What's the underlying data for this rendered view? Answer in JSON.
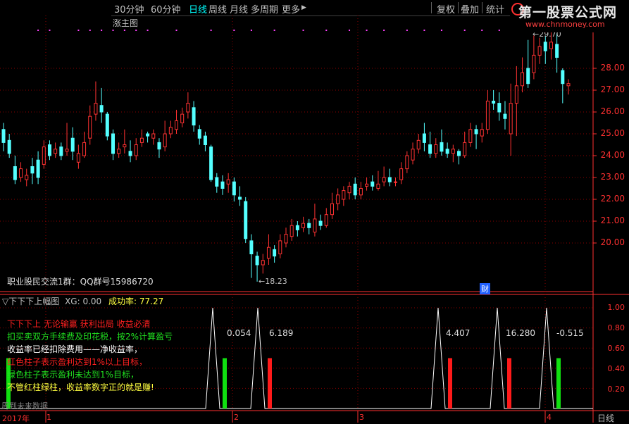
{
  "toolbar": {
    "periods": [
      "30分钟",
      "60分钟",
      "日线",
      "周线",
      "月线",
      "多周期",
      "更多"
    ],
    "active_index": 2,
    "more_arrow": "▶",
    "right_buttons": [
      "复权",
      "叠加",
      "统计"
    ]
  },
  "logo": {
    "main": "第一股票公式网",
    "sub": "www.chnmoney.com"
  },
  "main_chart": {
    "title": "涨主图",
    "label_high": "29.70",
    "label_low": "18.23",
    "qq_text": "职业股民交流1群：QQ群号15986720",
    "cai_badge": "财",
    "price_ticks": [
      "28.00",
      "27.00",
      "26.00",
      "25.00",
      "24.00",
      "23.00",
      "22.00",
      "21.00",
      "20.00"
    ],
    "ymin": 18.0,
    "ymax": 30.2,
    "candles": [
      {
        "o": 25.2,
        "c": 24.6,
        "h": 25.5,
        "l": 24.2
      },
      {
        "o": 24.7,
        "c": 24.1,
        "h": 25.0,
        "l": 23.9
      },
      {
        "o": 23.5,
        "c": 22.9,
        "h": 24.0,
        "l": 22.7
      },
      {
        "o": 23.0,
        "c": 23.4,
        "h": 23.7,
        "l": 22.8
      },
      {
        "o": 22.9,
        "c": 23.1,
        "h": 23.4,
        "l": 22.6
      },
      {
        "o": 23.5,
        "c": 23.2,
        "h": 23.9,
        "l": 22.7
      },
      {
        "o": 23.8,
        "c": 23.0,
        "h": 24.2,
        "l": 22.7
      },
      {
        "o": 23.6,
        "c": 24.4,
        "h": 24.7,
        "l": 23.4
      },
      {
        "o": 24.5,
        "c": 24.0,
        "h": 24.7,
        "l": 23.8
      },
      {
        "o": 24.1,
        "c": 24.3,
        "h": 24.6,
        "l": 23.9
      },
      {
        "o": 24.4,
        "c": 24.0,
        "h": 24.6,
        "l": 23.8
      },
      {
        "o": 24.2,
        "c": 24.3,
        "h": 25.5,
        "l": 24.0
      },
      {
        "o": 24.8,
        "c": 24.2,
        "h": 25.3,
        "l": 23.8
      },
      {
        "o": 23.7,
        "c": 24.1,
        "h": 24.5,
        "l": 23.4
      },
      {
        "o": 24.0,
        "c": 24.6,
        "h": 25.1,
        "l": 23.9
      },
      {
        "o": 24.8,
        "c": 25.8,
        "h": 26.3,
        "l": 24.5
      },
      {
        "o": 25.9,
        "c": 26.4,
        "h": 27.4,
        "l": 25.6
      },
      {
        "o": 26.3,
        "c": 26.0,
        "h": 27.1,
        "l": 25.5
      },
      {
        "o": 25.9,
        "c": 24.9,
        "h": 26.0,
        "l": 24.7
      },
      {
        "o": 25.0,
        "c": 24.1,
        "h": 25.2,
        "l": 23.8
      },
      {
        "o": 24.1,
        "c": 24.3,
        "h": 24.6,
        "l": 23.9
      },
      {
        "o": 24.4,
        "c": 24.5,
        "h": 25.2,
        "l": 24.1
      },
      {
        "o": 24.2,
        "c": 24.0,
        "h": 24.7,
        "l": 23.7
      },
      {
        "o": 24.0,
        "c": 24.5,
        "h": 24.8,
        "l": 23.8
      },
      {
        "o": 24.6,
        "c": 24.8,
        "h": 25.2,
        "l": 24.4
      },
      {
        "o": 25.0,
        "c": 24.9,
        "h": 25.1,
        "l": 24.6
      },
      {
        "o": 24.8,
        "c": 25.0,
        "h": 25.2,
        "l": 24.5
      },
      {
        "o": 24.6,
        "c": 24.3,
        "h": 24.8,
        "l": 23.9
      },
      {
        "o": 24.4,
        "c": 25.0,
        "h": 25.6,
        "l": 24.2
      },
      {
        "o": 25.0,
        "c": 25.3,
        "h": 25.6,
        "l": 24.8
      },
      {
        "o": 25.2,
        "c": 25.6,
        "h": 26.1,
        "l": 25.0
      },
      {
        "o": 25.5,
        "c": 25.9,
        "h": 26.2,
        "l": 25.3
      },
      {
        "o": 26.0,
        "c": 26.4,
        "h": 26.9,
        "l": 25.7
      },
      {
        "o": 26.2,
        "c": 25.4,
        "h": 26.5,
        "l": 25.1
      },
      {
        "o": 25.2,
        "c": 24.8,
        "h": 25.4,
        "l": 24.5
      },
      {
        "o": 24.9,
        "c": 24.5,
        "h": 25.1,
        "l": 24.2
      },
      {
        "o": 24.4,
        "c": 22.9,
        "h": 24.5,
        "l": 22.8
      },
      {
        "o": 23.0,
        "c": 22.6,
        "h": 23.2,
        "l": 22.3
      },
      {
        "o": 22.8,
        "c": 22.5,
        "h": 23.1,
        "l": 22.2
      },
      {
        "o": 22.7,
        "c": 22.9,
        "h": 23.2,
        "l": 22.3
      },
      {
        "o": 22.8,
        "c": 22.2,
        "h": 23.0,
        "l": 21.9
      },
      {
        "o": 22.1,
        "c": 22.0,
        "h": 22.6,
        "l": 21.7
      },
      {
        "o": 21.9,
        "c": 20.2,
        "h": 22.1,
        "l": 20.0
      },
      {
        "o": 20.1,
        "c": 19.5,
        "h": 20.4,
        "l": 18.4
      },
      {
        "o": 19.4,
        "c": 19.0,
        "h": 19.6,
        "l": 18.23
      },
      {
        "o": 19.0,
        "c": 19.2,
        "h": 19.5,
        "l": 18.6
      },
      {
        "o": 19.3,
        "c": 19.8,
        "h": 20.4,
        "l": 19.0
      },
      {
        "o": 19.7,
        "c": 19.4,
        "h": 19.9,
        "l": 19.1
      },
      {
        "o": 19.5,
        "c": 20.1,
        "h": 20.4,
        "l": 19.3
      },
      {
        "o": 20.0,
        "c": 20.4,
        "h": 20.7,
        "l": 19.8
      },
      {
        "o": 20.3,
        "c": 20.8,
        "h": 21.1,
        "l": 20.1
      },
      {
        "o": 20.8,
        "c": 20.6,
        "h": 21.0,
        "l": 20.3
      },
      {
        "o": 20.7,
        "c": 20.9,
        "h": 21.2,
        "l": 20.5
      },
      {
        "o": 20.9,
        "c": 20.7,
        "h": 21.1,
        "l": 20.4
      },
      {
        "o": 20.5,
        "c": 21.1,
        "h": 21.8,
        "l": 20.3
      },
      {
        "o": 21.0,
        "c": 20.8,
        "h": 21.3,
        "l": 20.6
      },
      {
        "o": 20.8,
        "c": 21.3,
        "h": 21.6,
        "l": 20.7
      },
      {
        "o": 21.3,
        "c": 21.8,
        "h": 22.3,
        "l": 21.1
      },
      {
        "o": 21.8,
        "c": 22.2,
        "h": 22.5,
        "l": 21.5
      },
      {
        "o": 22.0,
        "c": 22.4,
        "h": 22.6,
        "l": 21.7
      },
      {
        "o": 22.3,
        "c": 22.6,
        "h": 22.8,
        "l": 22.0
      },
      {
        "o": 22.7,
        "c": 22.2,
        "h": 23.0,
        "l": 22.0
      },
      {
        "o": 22.2,
        "c": 22.5,
        "h": 22.8,
        "l": 22.0
      },
      {
        "o": 22.6,
        "c": 22.7,
        "h": 23.0,
        "l": 22.4
      },
      {
        "o": 22.8,
        "c": 22.6,
        "h": 23.1,
        "l": 22.4
      },
      {
        "o": 22.5,
        "c": 22.7,
        "h": 23.3,
        "l": 22.4
      },
      {
        "o": 22.8,
        "c": 23.0,
        "h": 23.5,
        "l": 22.6
      },
      {
        "o": 23.0,
        "c": 22.8,
        "h": 23.4,
        "l": 22.6
      },
      {
        "o": 22.8,
        "c": 22.8,
        "h": 23.0,
        "l": 22.6
      },
      {
        "o": 22.9,
        "c": 23.4,
        "h": 23.7,
        "l": 22.7
      },
      {
        "o": 23.4,
        "c": 24.0,
        "h": 24.2,
        "l": 23.2
      },
      {
        "o": 23.8,
        "c": 24.3,
        "h": 24.6,
        "l": 23.6
      },
      {
        "o": 24.3,
        "c": 24.7,
        "h": 25.0,
        "l": 24.1
      },
      {
        "o": 25.0,
        "c": 24.6,
        "h": 25.5,
        "l": 24.2
      },
      {
        "o": 24.5,
        "c": 24.1,
        "h": 25.1,
        "l": 23.9
      },
      {
        "o": 24.1,
        "c": 24.5,
        "h": 24.8,
        "l": 23.9
      },
      {
        "o": 24.6,
        "c": 24.2,
        "h": 25.2,
        "l": 24.0
      },
      {
        "o": 24.3,
        "c": 24.1,
        "h": 24.6,
        "l": 23.9
      },
      {
        "o": 24.1,
        "c": 24.3,
        "h": 24.5,
        "l": 23.7
      },
      {
        "o": 24.2,
        "c": 24.0,
        "h": 24.3,
        "l": 23.6
      },
      {
        "o": 24.0,
        "c": 24.6,
        "h": 25.1,
        "l": 23.9
      },
      {
        "o": 24.6,
        "c": 25.2,
        "h": 25.5,
        "l": 24.4
      },
      {
        "o": 25.2,
        "c": 25.0,
        "h": 25.4,
        "l": 24.3
      },
      {
        "o": 24.9,
        "c": 25.2,
        "h": 25.5,
        "l": 24.6
      },
      {
        "o": 25.2,
        "c": 26.5,
        "h": 27.0,
        "l": 25.0
      },
      {
        "o": 26.5,
        "c": 26.4,
        "h": 27.0,
        "l": 26.1
      },
      {
        "o": 26.4,
        "c": 26.0,
        "h": 26.9,
        "l": 25.6
      },
      {
        "o": 25.9,
        "c": 25.7,
        "h": 26.5,
        "l": 25.2
      },
      {
        "o": 25.0,
        "c": 26.4,
        "h": 27.3,
        "l": 24.0
      },
      {
        "o": 26.4,
        "c": 27.2,
        "h": 28.1,
        "l": 24.9
      },
      {
        "o": 27.2,
        "c": 27.8,
        "h": 28.5,
        "l": 26.9
      },
      {
        "o": 28.0,
        "c": 27.3,
        "h": 29.3,
        "l": 27.1
      },
      {
        "o": 27.8,
        "c": 28.6,
        "h": 29.5,
        "l": 27.5
      },
      {
        "o": 28.6,
        "c": 29.0,
        "h": 29.4,
        "l": 28.2
      },
      {
        "o": 29.2,
        "c": 28.8,
        "h": 29.5,
        "l": 28.2
      },
      {
        "o": 28.9,
        "c": 29.2,
        "h": 29.7,
        "l": 28.4
      },
      {
        "o": 29.1,
        "c": 28.5,
        "h": 29.6,
        "l": 27.8
      },
      {
        "o": 27.9,
        "c": 27.3,
        "h": 28.0,
        "l": 26.4
      },
      {
        "o": 27.2,
        "c": 27.3,
        "h": 27.5,
        "l": 26.8
      }
    ],
    "top_dots": [
      6,
      8,
      13,
      15,
      17,
      19,
      21,
      23,
      25,
      30,
      36,
      40,
      43,
      47,
      52,
      56,
      60,
      63,
      66,
      70,
      73,
      76,
      80,
      83,
      86,
      90,
      93,
      96
    ]
  },
  "indicator": {
    "title": "下下下上幅图",
    "xg_text": "XG: 0.00",
    "rate_text": "成功率: 77.27",
    "ticks": [
      "1.00",
      "0.80",
      "0.60",
      "0.40",
      "0.20"
    ],
    "spike_values": [
      "0.054",
      "6.189",
      "4.407",
      "16.280",
      "-0.515"
    ],
    "spikes": [
      {
        "t": 302,
        "color": "green",
        "value": 1.0
      },
      {
        "t": 366,
        "color": "red",
        "value": 1.0
      },
      {
        "t": 622,
        "color": "red",
        "value": 1.0
      },
      {
        "t": 706,
        "color": "red",
        "value": 1.0
      },
      {
        "t": 776,
        "color": "green",
        "value": 1.0
      }
    ],
    "left_green_bar": 1.0,
    "notes": [
      {
        "text": "下下下上 无论输赢 获利出局 收益必清",
        "color": "#ff2020"
      },
      {
        "text": "扣买卖双方手续费及印花税，按2%计算盈亏",
        "color": "#20e020"
      },
      {
        "text": "收益率已经扣除费用——净收益率，",
        "color": "#ffffff"
      },
      {
        "text": "红色柱子表示盈利达到1%以上目标，",
        "color": "#ff2020"
      },
      {
        "text": "绿色柱子表示盈利未达到1%目标，",
        "color": "#20e020"
      },
      {
        "text": "不管红柱绿柱，收益率数字正的就是赚!",
        "color": "#ffff40"
      }
    ],
    "future_text": "周到未来数据"
  },
  "bottom_axis": {
    "labels": [
      "2017年",
      "1",
      "2",
      "3",
      "4"
    ],
    "period_tag": "日线"
  },
  "colors": {
    "up": "#ff3232",
    "down": "#54ffff",
    "grid": "#8b0000",
    "axis": "#ff3030"
  }
}
